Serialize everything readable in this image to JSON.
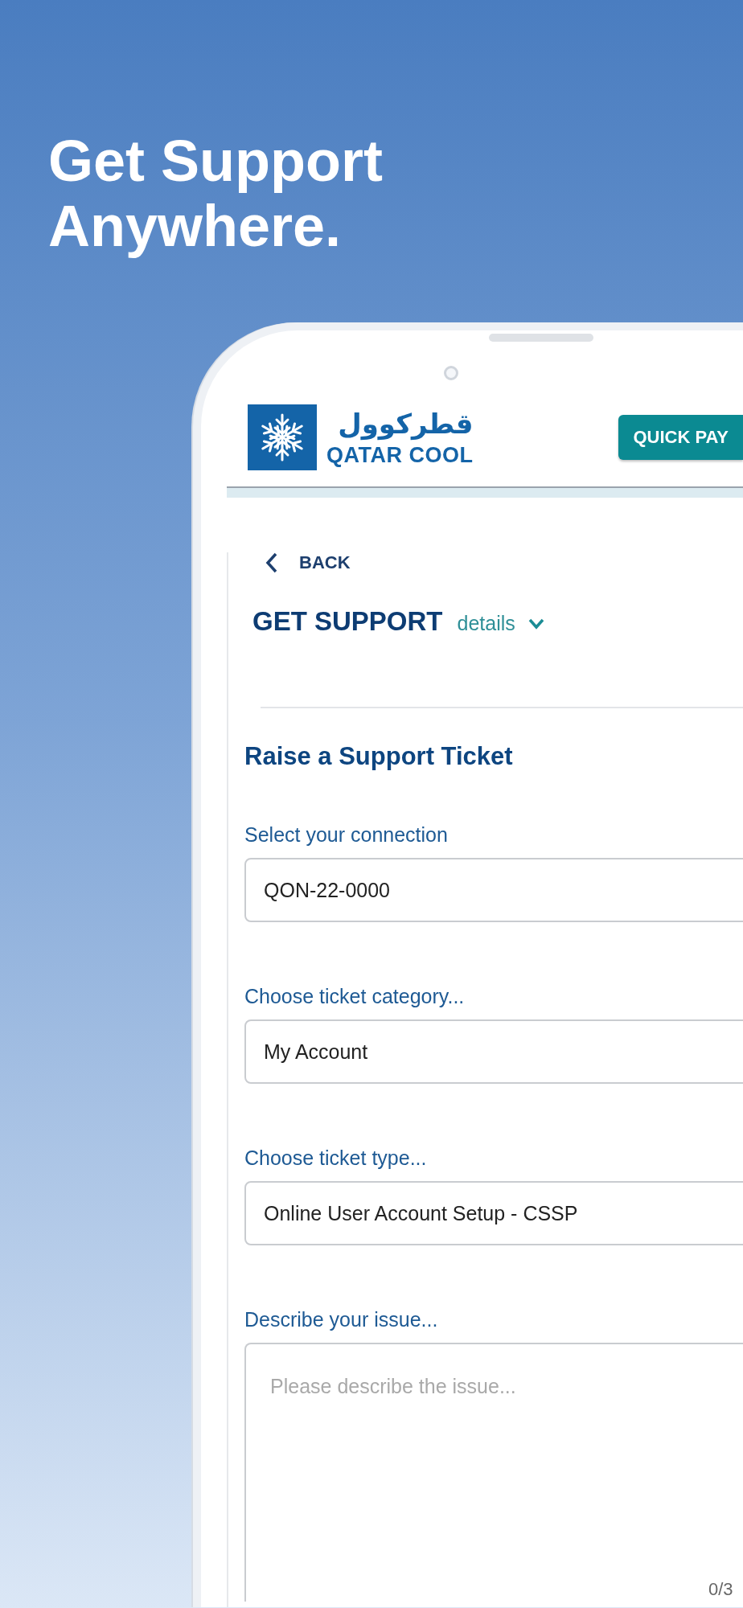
{
  "headline": "Get Support Anywhere.",
  "app": {
    "logo": {
      "arabic": "قطركوول",
      "english": "QATAR COOL"
    },
    "quick_pay_button": "QUICK PAY",
    "back_link": "BACK",
    "page_title": "GET SUPPORT",
    "details_toggle": {
      "label": "details",
      "expanded": false
    },
    "form_title": "Raise a Support Ticket",
    "fields": [
      {
        "kind": "select",
        "label": "Select your connection",
        "value": "QON-22-0000"
      },
      {
        "kind": "select",
        "label": "Choose ticket category...",
        "value": "My Account"
      },
      {
        "kind": "select",
        "label": "Choose ticket type...",
        "value": "Online User Account Setup - CSSP"
      },
      {
        "kind": "textarea",
        "label": "Describe your issue...",
        "placeholder": "Please describe the issue...",
        "counter": "0/3"
      }
    ]
  }
}
